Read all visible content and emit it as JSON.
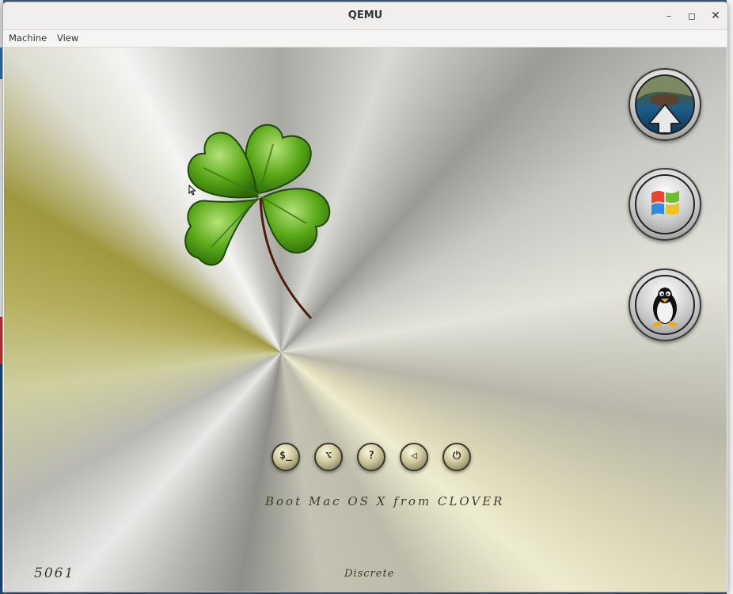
{
  "window": {
    "title": "QEMU",
    "controls": {
      "minimize": "–",
      "maximize": "◻",
      "close": "✕"
    }
  },
  "menubar": {
    "items": [
      {
        "label": "Machine"
      },
      {
        "label": "View"
      }
    ]
  },
  "screen": {
    "logo": "clover-leaf",
    "boot_entries": [
      {
        "name": "macos",
        "icon": "macos-disk-icon"
      },
      {
        "name": "windows",
        "icon": "windows-logo-icon"
      },
      {
        "name": "linux",
        "icon": "tux-penguin-icon"
      }
    ],
    "tool_buttons": [
      {
        "glyph": "$_",
        "icon": "shell-icon"
      },
      {
        "glyph": "⌥",
        "icon": "options-icon"
      },
      {
        "glyph": "?",
        "icon": "help-icon"
      },
      {
        "glyph": "◁",
        "icon": "reset-icon"
      },
      {
        "glyph": "⏻",
        "icon": "power-icon"
      }
    ],
    "selected_entry_label": "Boot Mac OS X from CLOVER",
    "revision": "5061",
    "mode_label": "Discrete"
  },
  "colors": {
    "clover_green": "#5aa818",
    "windows_red": "#e8452c",
    "windows_green": "#6cbf2a",
    "windows_blue": "#2d8be0",
    "windows_yellow": "#f4c21a"
  }
}
